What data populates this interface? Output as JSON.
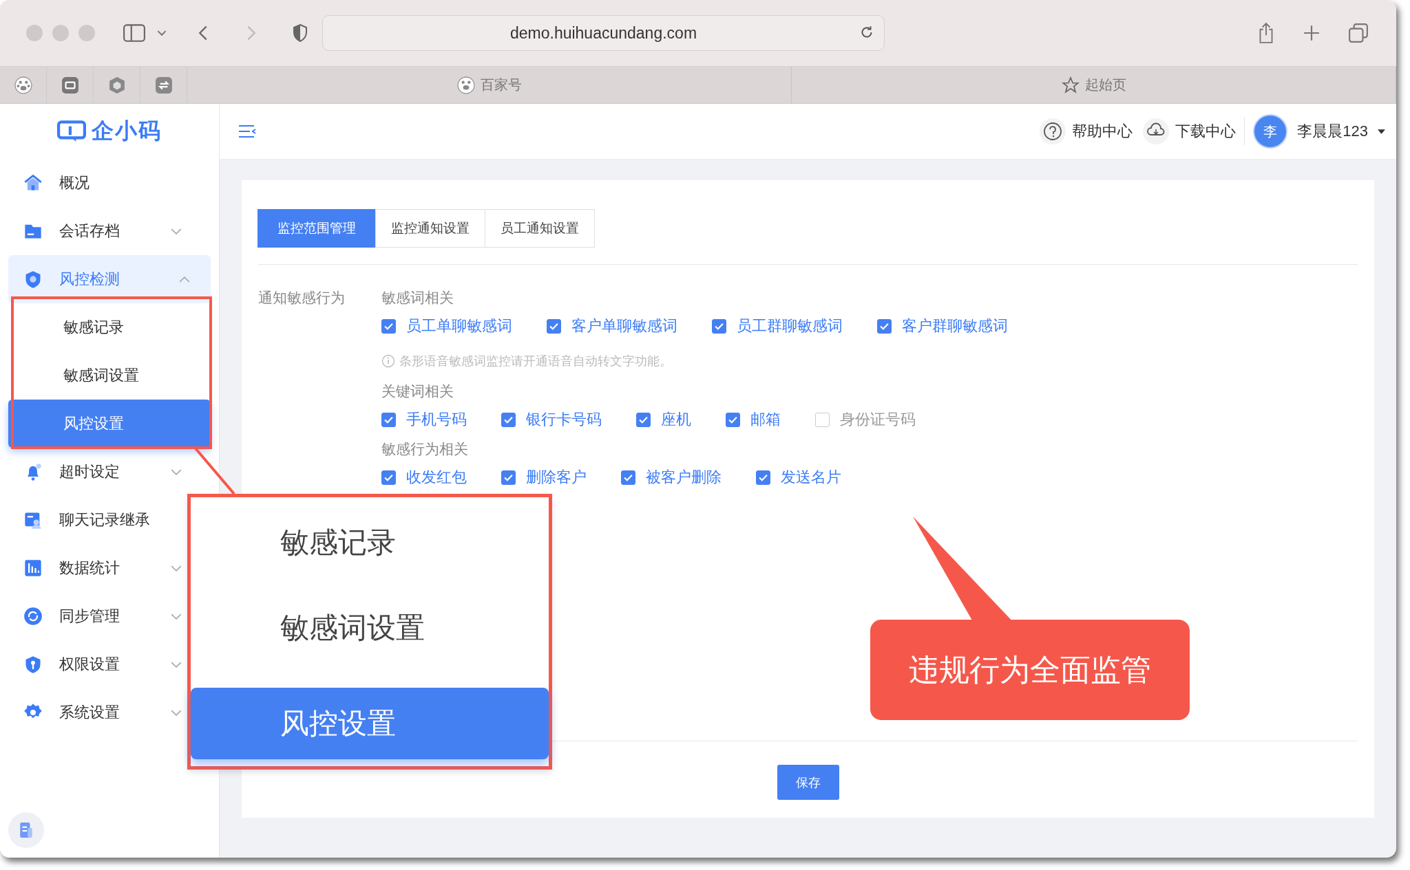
{
  "browser": {
    "url": "demo.huihuacundang.com",
    "tabs": [
      {
        "label": "百家号",
        "selected": false
      },
      {
        "label": "起始页",
        "selected": false
      }
    ]
  },
  "header": {
    "help": "帮助中心",
    "download": "下载中心",
    "avatar": "李",
    "user": "李晨晨123"
  },
  "sidebar": {
    "logo": "企小码",
    "items": [
      {
        "label": "概况",
        "kind": "link",
        "selected": false
      },
      {
        "label": "会话存档",
        "kind": "group",
        "expanded": false,
        "selected": false
      },
      {
        "label": "风控检测",
        "kind": "group",
        "expanded": true,
        "selected": true,
        "children": [
          {
            "label": "敏感记录",
            "selected": false
          },
          {
            "label": "敏感词设置",
            "selected": false
          },
          {
            "label": "风控设置",
            "selected": true
          }
        ]
      },
      {
        "label": "超时设定",
        "kind": "group",
        "expanded": false,
        "selected": false
      },
      {
        "label": "聊天记录继承",
        "kind": "link",
        "selected": false
      },
      {
        "label": "数据统计",
        "kind": "group",
        "expanded": false,
        "selected": false
      },
      {
        "label": "同步管理",
        "kind": "group",
        "expanded": false,
        "selected": false
      },
      {
        "label": "权限设置",
        "kind": "group",
        "expanded": false,
        "selected": false
      },
      {
        "label": "系统设置",
        "kind": "group",
        "expanded": false,
        "selected": false
      }
    ]
  },
  "tabs": [
    {
      "label": "监控范围管理",
      "selected": true
    },
    {
      "label": "监控通知设置",
      "selected": false
    },
    {
      "label": "员工通知设置",
      "selected": false
    }
  ],
  "form": {
    "label": "通知敏感行为",
    "groups": [
      {
        "title": "敏感词相关",
        "hint": "条形语音敏感词监控请开通语音自动转文字功能。",
        "options": [
          {
            "label": "员工单聊敏感词",
            "checked": true
          },
          {
            "label": "客户单聊敏感词",
            "checked": true
          },
          {
            "label": "员工群聊敏感词",
            "checked": true
          },
          {
            "label": "客户群聊敏感词",
            "checked": true
          }
        ]
      },
      {
        "title": "关键词相关",
        "options": [
          {
            "label": "手机号码",
            "checked": true
          },
          {
            "label": "银行卡号码",
            "checked": true
          },
          {
            "label": "座机",
            "checked": true
          },
          {
            "label": "邮箱",
            "checked": true
          },
          {
            "label": "身份证号码",
            "checked": false
          }
        ]
      },
      {
        "title": "敏感行为相关",
        "options": [
          {
            "label": "收发红包",
            "checked": true
          },
          {
            "label": "删除客户",
            "checked": true
          },
          {
            "label": "被客户删除",
            "checked": true
          },
          {
            "label": "发送名片",
            "checked": true
          }
        ]
      }
    ]
  },
  "save": "保存",
  "annotation": {
    "zoom_items": [
      {
        "label": "敏感记录",
        "selected": false
      },
      {
        "label": "敏感词设置",
        "selected": false
      },
      {
        "label": "风控设置",
        "selected": true
      }
    ],
    "callout": "违规行为全面监管"
  }
}
